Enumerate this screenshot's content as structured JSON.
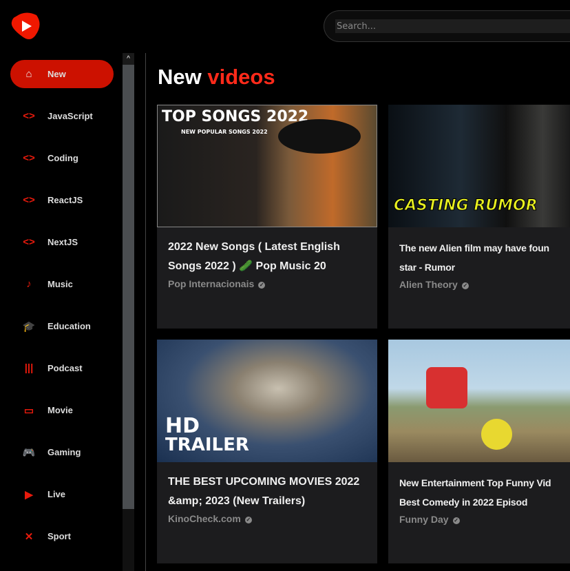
{
  "app": {
    "logo_text": "YT"
  },
  "search": {
    "placeholder": "Search..."
  },
  "scrollbar": {
    "up": "^"
  },
  "sidebar": {
    "items": [
      {
        "label": "New",
        "icon": "home-icon",
        "glyph": "⌂"
      },
      {
        "label": "JavaScript",
        "icon": "code-icon",
        "glyph": "<>"
      },
      {
        "label": "Coding",
        "icon": "code-icon",
        "glyph": "<>"
      },
      {
        "label": "ReactJS",
        "icon": "code-icon",
        "glyph": "<>"
      },
      {
        "label": "NextJS",
        "icon": "code-icon",
        "glyph": "<>"
      },
      {
        "label": "Music",
        "icon": "music-note-icon",
        "glyph": "♪"
      },
      {
        "label": "Education",
        "icon": "graduation-cap-icon",
        "glyph": "🎓"
      },
      {
        "label": "Podcast",
        "icon": "podcast-icon",
        "glyph": "|||"
      },
      {
        "label": "Movie",
        "icon": "tv-icon",
        "glyph": "▭"
      },
      {
        "label": "Gaming",
        "icon": "gamepad-icon",
        "glyph": "🎮"
      },
      {
        "label": "Live",
        "icon": "live-tv-icon",
        "glyph": "▶"
      },
      {
        "label": "Sport",
        "icon": "dumbbell-icon",
        "glyph": "✕"
      }
    ]
  },
  "main": {
    "title_a": "New",
    "title_b": "videos",
    "videos": [
      {
        "title1": "2022 New Songs ( Latest English",
        "title2": "Songs 2022 ) 🥒 Pop Music 20",
        "channel": "Pop Internacionais",
        "thumb_text": "TOP SONGS 2022",
        "thumb_sub": "NEW POPULAR SONGS 2022"
      },
      {
        "title1": "The new Alien film may have foun",
        "title2": "star - Rumor",
        "channel": "Alien Theory",
        "thumb_text": "CASTING RUMOR"
      },
      {
        "title1": "THE BEST UPCOMING MOVIES 2022",
        "title2": "&amp; 2023 (New Trailers)",
        "channel": "KinoCheck.com",
        "thumb_text": "HD",
        "thumb_sub": "TRAILER"
      },
      {
        "title1": "New Entertainment Top Funny Vid",
        "title2": "Best Comedy in 2022 Episod",
        "channel": "Funny Day"
      }
    ]
  }
}
